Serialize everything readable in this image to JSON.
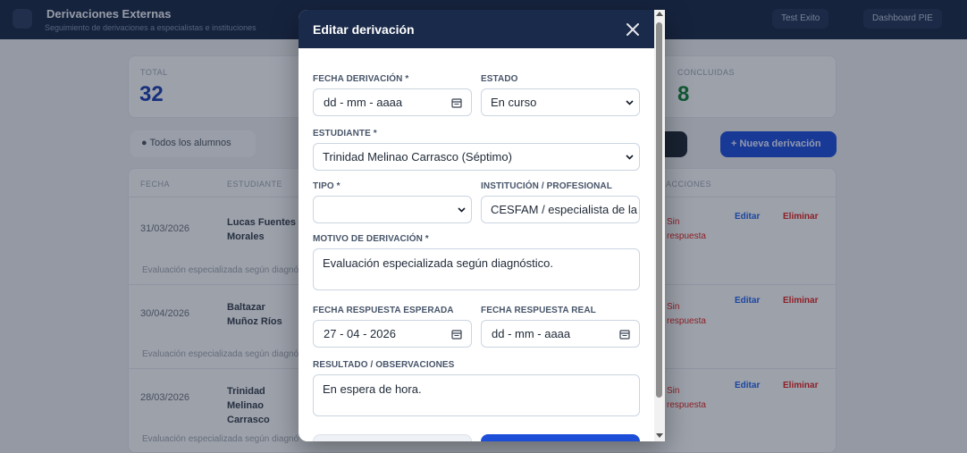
{
  "app": {
    "title": "Derivaciones Externas",
    "subtitle": "Seguimiento de derivaciones a especialistas e instituciones",
    "buttons": [
      "Test Exito",
      "Dashboard PIE"
    ]
  },
  "stats": [
    {
      "label": "TOTAL",
      "value": "32",
      "color": "#1e40af"
    },
    {
      "label": "CONCLUIDAS",
      "value": "8",
      "color": "#15803d"
    }
  ],
  "filter": {
    "label": "Todos los alumnos"
  },
  "new_button": "+ Nueva derivación",
  "table": {
    "headers": [
      "FECHA",
      "ESTUDIANTE",
      "ACCIONES"
    ],
    "rows": [
      {
        "date": "31/03/2026",
        "name": "Lucas Fuentes Morales",
        "motivo": "Evaluación especializada según diagnóstico.",
        "status": "Sin respuesta",
        "edit": "Editar",
        "delete": "Eliminar"
      },
      {
        "date": "30/04/2026",
        "name": "Baltazar Muñoz Ríos",
        "motivo": "Evaluación especializada según diagnóstico.",
        "status": "Sin respuesta",
        "edit": "Editar",
        "delete": "Eliminar"
      },
      {
        "date": "28/03/2026",
        "name": "Trinidad Melinao Carrasco",
        "motivo": "Evaluación especializada según diagnóstico.",
        "status": "Sin respuesta",
        "edit": "Editar",
        "delete": "Eliminar"
      }
    ]
  },
  "modal": {
    "title": "Editar derivación",
    "fields": {
      "fecha_derivacion": {
        "label": "FECHA DERIVACIÓN *",
        "value": "dd - mm - aaaa"
      },
      "estado": {
        "label": "ESTADO",
        "value": "En curso"
      },
      "estudiante": {
        "label": "ESTUDIANTE *",
        "value": "Trinidad Melinao Carrasco (Séptimo)"
      },
      "tipo": {
        "label": "TIPO *",
        "value": ""
      },
      "institucion": {
        "label": "INSTITUCIÓN / PROFESIONAL",
        "value": "CESFAM / especialista de la re"
      },
      "motivo": {
        "label": "MOTIVO DE DERIVACIÓN *",
        "value": "Evaluación especializada según diagnóstico."
      },
      "fecha_esperada": {
        "label": "FECHA RESPUESTA ESPERADA",
        "value": "27 - 04 - 2026"
      },
      "fecha_real": {
        "label": "FECHA RESPUESTA REAL",
        "value": "dd - mm - aaaa"
      },
      "resultado": {
        "label": "RESULTADO / OBSERVACIONES",
        "value": "En espera de hora."
      }
    }
  },
  "icons": {
    "close": "close-icon",
    "calendar": "calendar-icon",
    "chevron": "chevron-down-icon"
  },
  "colors": {
    "header": "#1a2a4a",
    "primary": "#1d4ed8",
    "danger": "#dc2626"
  }
}
